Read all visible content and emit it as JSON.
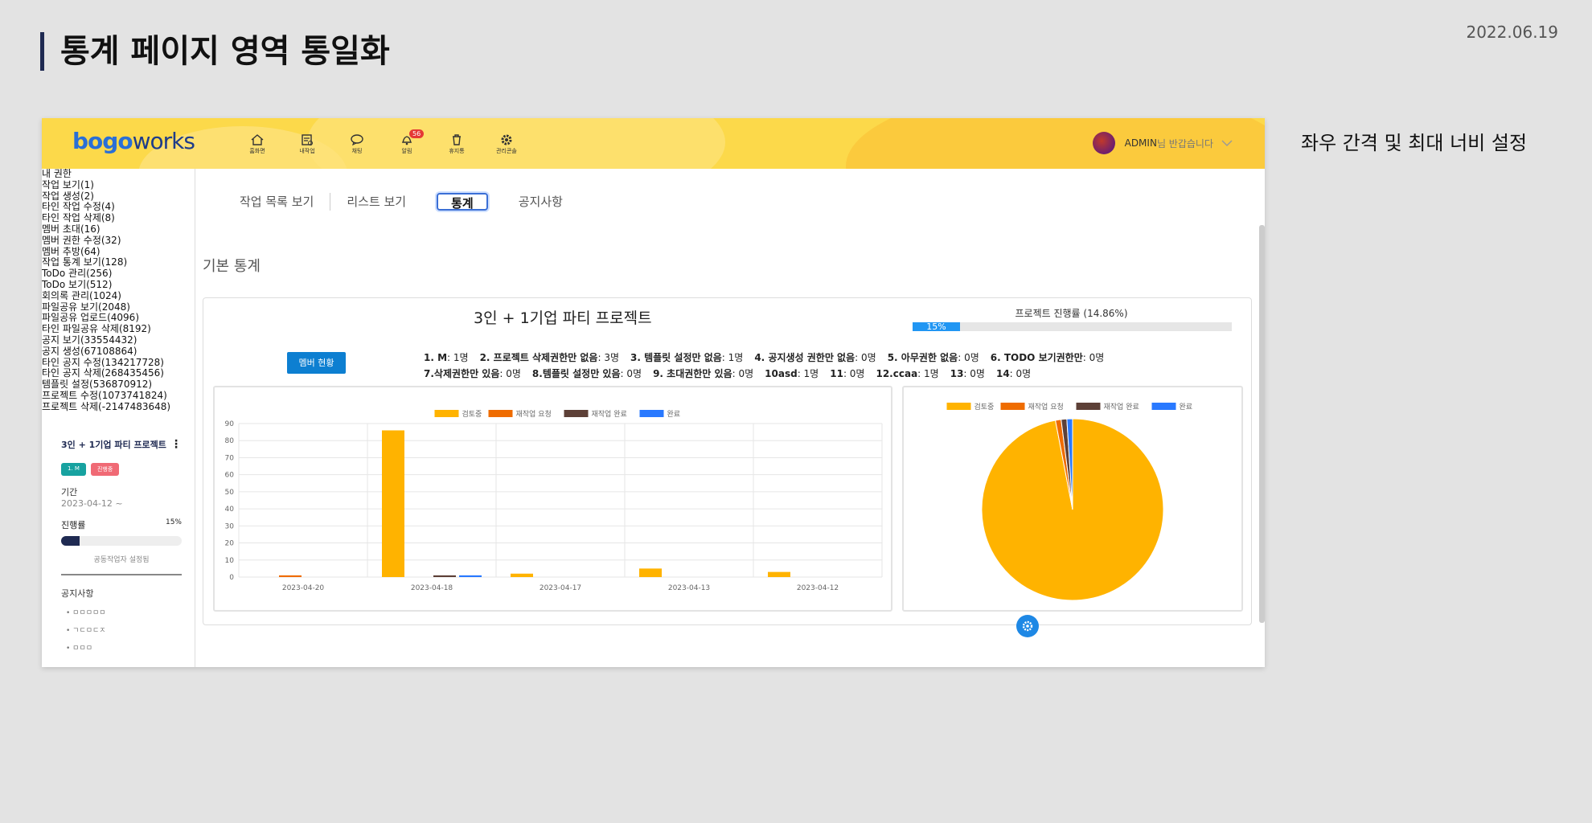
{
  "slide": {
    "title": "통계 페이지 영역 통일화",
    "date": "2022.06.19",
    "note": "좌우 간격 및 최대 너비 설정"
  },
  "header": {
    "logo": {
      "brand1": "bogo",
      "brand2": "works"
    },
    "nav": [
      {
        "label": "홈화면",
        "icon": "home-icon"
      },
      {
        "label": "내작업",
        "icon": "task-icon"
      },
      {
        "label": "채팅",
        "icon": "chat-icon"
      },
      {
        "label": "알림",
        "icon": "bell-icon",
        "badge": "56"
      },
      {
        "label": "휴지통",
        "icon": "trash-icon"
      },
      {
        "label": "관리콘솔",
        "icon": "gear-icon"
      }
    ],
    "user": {
      "name": "ADMIN",
      "greeting": "님 반갑습니다"
    }
  },
  "sidebar": {
    "permissions": [
      "내 권한",
      "작업 보기(1)",
      "작업 생성(2)",
      "타인 작업 수정(4)",
      "타인 작업 삭제(8)",
      "멤버 초대(16)",
      "멤버 권한 수정(32)",
      "멤버 추방(64)",
      "작업 통계 보기(128)",
      "ToDo 관리(256)",
      "ToDo 보기(512)",
      "회의록 관리(1024)",
      "파일공유 보기(2048)",
      "파일공유 업로드(4096)",
      "타인 파일공유 삭제(8192)",
      "공지 보기(33554432)",
      "공지 생성(67108864)",
      "타인 공지 수정(134217728)",
      "타인 공지 삭제(268435456)",
      "템플릿 설정(536870912)",
      "프로젝트 수정(1073741824)",
      "프로젝트 삭제(-2147483648)"
    ],
    "project": {
      "title": "3인 + 1기업 파티 프로젝트",
      "tag1": "1. M",
      "tag2": "진행중",
      "period_label": "기간",
      "period": "2023-04-12 ~",
      "progress_label": "진행률",
      "progress": "15%",
      "progress_value": 0.15,
      "coworker": "공동작업자 설정됨"
    },
    "notice": {
      "title": "공지사항",
      "items": [
        "ㅁㅁㅁㅁㅁ",
        "ㄱㄷㅁㄷㅈ",
        "ㅁㅁㅁ"
      ]
    }
  },
  "tabs": [
    "작업 목록 보기",
    "리스트 보기",
    "통계",
    "공지사항"
  ],
  "section_title": "기본 통계",
  "stats": {
    "project_name": "3인 + 1기업 파티 프로젝트",
    "progress_label": "프로젝트 진행률 (14.86%)",
    "progress_text": "15%",
    "progress_value": 0.1486,
    "member_button": "멤버 현황",
    "counts": [
      {
        "k": "1. M",
        "v": "1명"
      },
      {
        "k": "2. 프로젝트 삭제권한만 없음",
        "v": "3명"
      },
      {
        "k": "3. 템플릿 설정만 없음",
        "v": "1명"
      },
      {
        "k": "4. 공지생성 권한만 없음",
        "v": "0명"
      },
      {
        "k": "5. 아무권한 없음",
        "v": "0명"
      },
      {
        "k": "6. TODO 보기권한만",
        "v": "0명"
      },
      {
        "k": "7.삭제권한만 있음",
        "v": "0명"
      },
      {
        "k": "8.템플릿 설정만 있음",
        "v": "0명"
      },
      {
        "k": "9. 초대권한만 있음",
        "v": "0명"
      },
      {
        "k": "10asd",
        "v": "1명"
      },
      {
        "k": "11",
        "v": "0명"
      },
      {
        "k": "12.ccaa",
        "v": "1명"
      },
      {
        "k": "13",
        "v": "0명"
      },
      {
        "k": "14",
        "v": "0명"
      }
    ]
  },
  "colors": {
    "review": "#ffb300",
    "rework_req": "#ef6c00",
    "rework_done": "#5d4037",
    "done": "#2979ff"
  },
  "chart_data": [
    {
      "type": "bar",
      "categories": [
        "2023-04-20",
        "2023-04-18",
        "2023-04-17",
        "2023-04-13",
        "2023-04-12"
      ],
      "series": [
        {
          "name": "검토중",
          "values": [
            0,
            86,
            2,
            5,
            3
          ]
        },
        {
          "name": "재작업 요청",
          "values": [
            1,
            0,
            0,
            0,
            0
          ]
        },
        {
          "name": "재작업 완료",
          "values": [
            0,
            1,
            0,
            0,
            0
          ]
        },
        {
          "name": "완료",
          "values": [
            0,
            1,
            0,
            0,
            0
          ]
        }
      ],
      "yticks": [
        0,
        10,
        20,
        30,
        40,
        50,
        60,
        70,
        80,
        90
      ],
      "ylim": [
        0,
        90
      ],
      "grid": true,
      "legend": "top"
    },
    {
      "type": "pie",
      "labels": [
        "검토중",
        "재작업 요청",
        "재작업 완료",
        "완료"
      ],
      "values": [
        96,
        1,
        1,
        1
      ],
      "legend": "top"
    }
  ]
}
